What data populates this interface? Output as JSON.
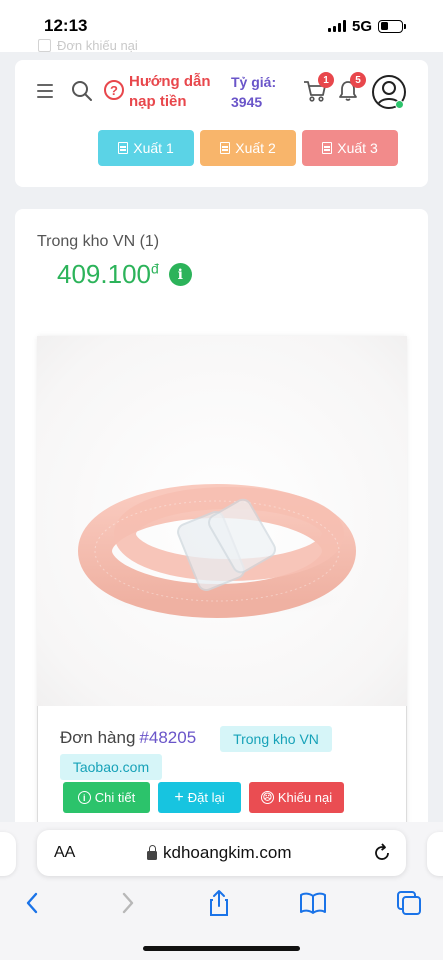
{
  "status": {
    "time": "12:13",
    "network": "5G"
  },
  "ghost": {
    "text": "Đơn khiếu nại"
  },
  "header": {
    "help_text": "Hướng dẫn nạp tiền",
    "rate_label": "Tỷ giá:",
    "rate_value": "3945",
    "cart_count": "1",
    "notification_count": "5",
    "icons": [
      "menu-icon",
      "search-icon",
      "question-circle-icon",
      "cart-icon",
      "bell-icon",
      "user-avatar-icon"
    ]
  },
  "exports": [
    {
      "label": "Xuất 1",
      "color": "#5bd3e6"
    },
    {
      "label": "Xuất 2",
      "color": "#f8b56b"
    },
    {
      "label": "Xuất 3",
      "color": "#f28b8b"
    }
  ],
  "warehouse": {
    "title": "Trong kho VN (1)",
    "price": "409.100",
    "currency": "đ"
  },
  "order": {
    "label": "Đơn hàng",
    "number": "#48205",
    "status_tag": "Trong kho VN",
    "source_tag": "Taobao.com",
    "actions": [
      {
        "label": "Chi tiết",
        "color": "#2cc36b",
        "icon": "info-circle-icon"
      },
      {
        "label": "Đặt lại",
        "color": "#17c4e0",
        "icon": "plus-icon"
      },
      {
        "label": "Khiếu nại",
        "color": "#ea4d52",
        "icon": "frown-icon"
      }
    ]
  },
  "browser": {
    "aa_label": "AA",
    "url": "kdhoangkim.com"
  },
  "colors": {
    "accent_green": "#2cb35a",
    "accent_red": "#e8474c",
    "accent_purple": "#6a55c9",
    "tag_bg": "#d6f5f8",
    "tag_text": "#17a2b8"
  }
}
